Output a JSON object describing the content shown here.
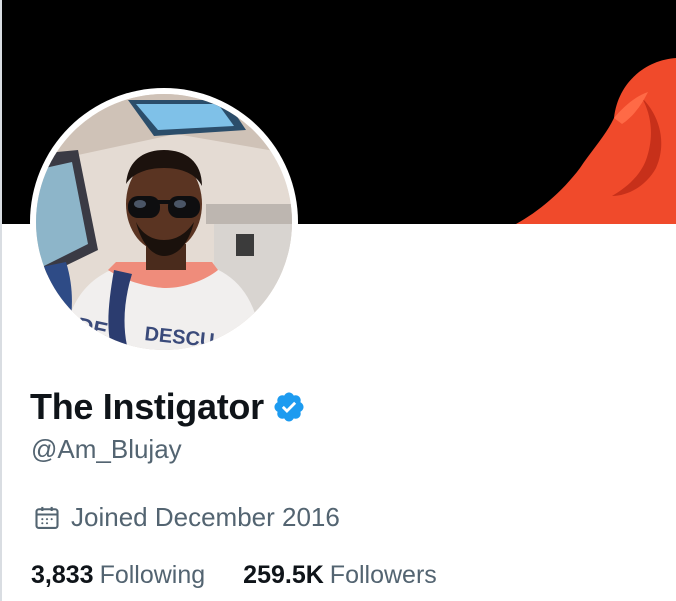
{
  "profile": {
    "display_name": "The Instigator",
    "handle": "@Am_Blujay",
    "verified_icon": "verified-badge-icon",
    "joined_icon": "calendar-icon",
    "joined_text": "Joined December 2016",
    "stats": {
      "following_count": "3,833",
      "following_label": "Following",
      "followers_count": "259.5K",
      "followers_label": "Followers"
    }
  },
  "colors": {
    "banner": "#000000",
    "text_primary": "#0f1419",
    "text_secondary": "#536471",
    "verified": "#1d9bf0",
    "banner_hoodie": "#f04a2b"
  }
}
